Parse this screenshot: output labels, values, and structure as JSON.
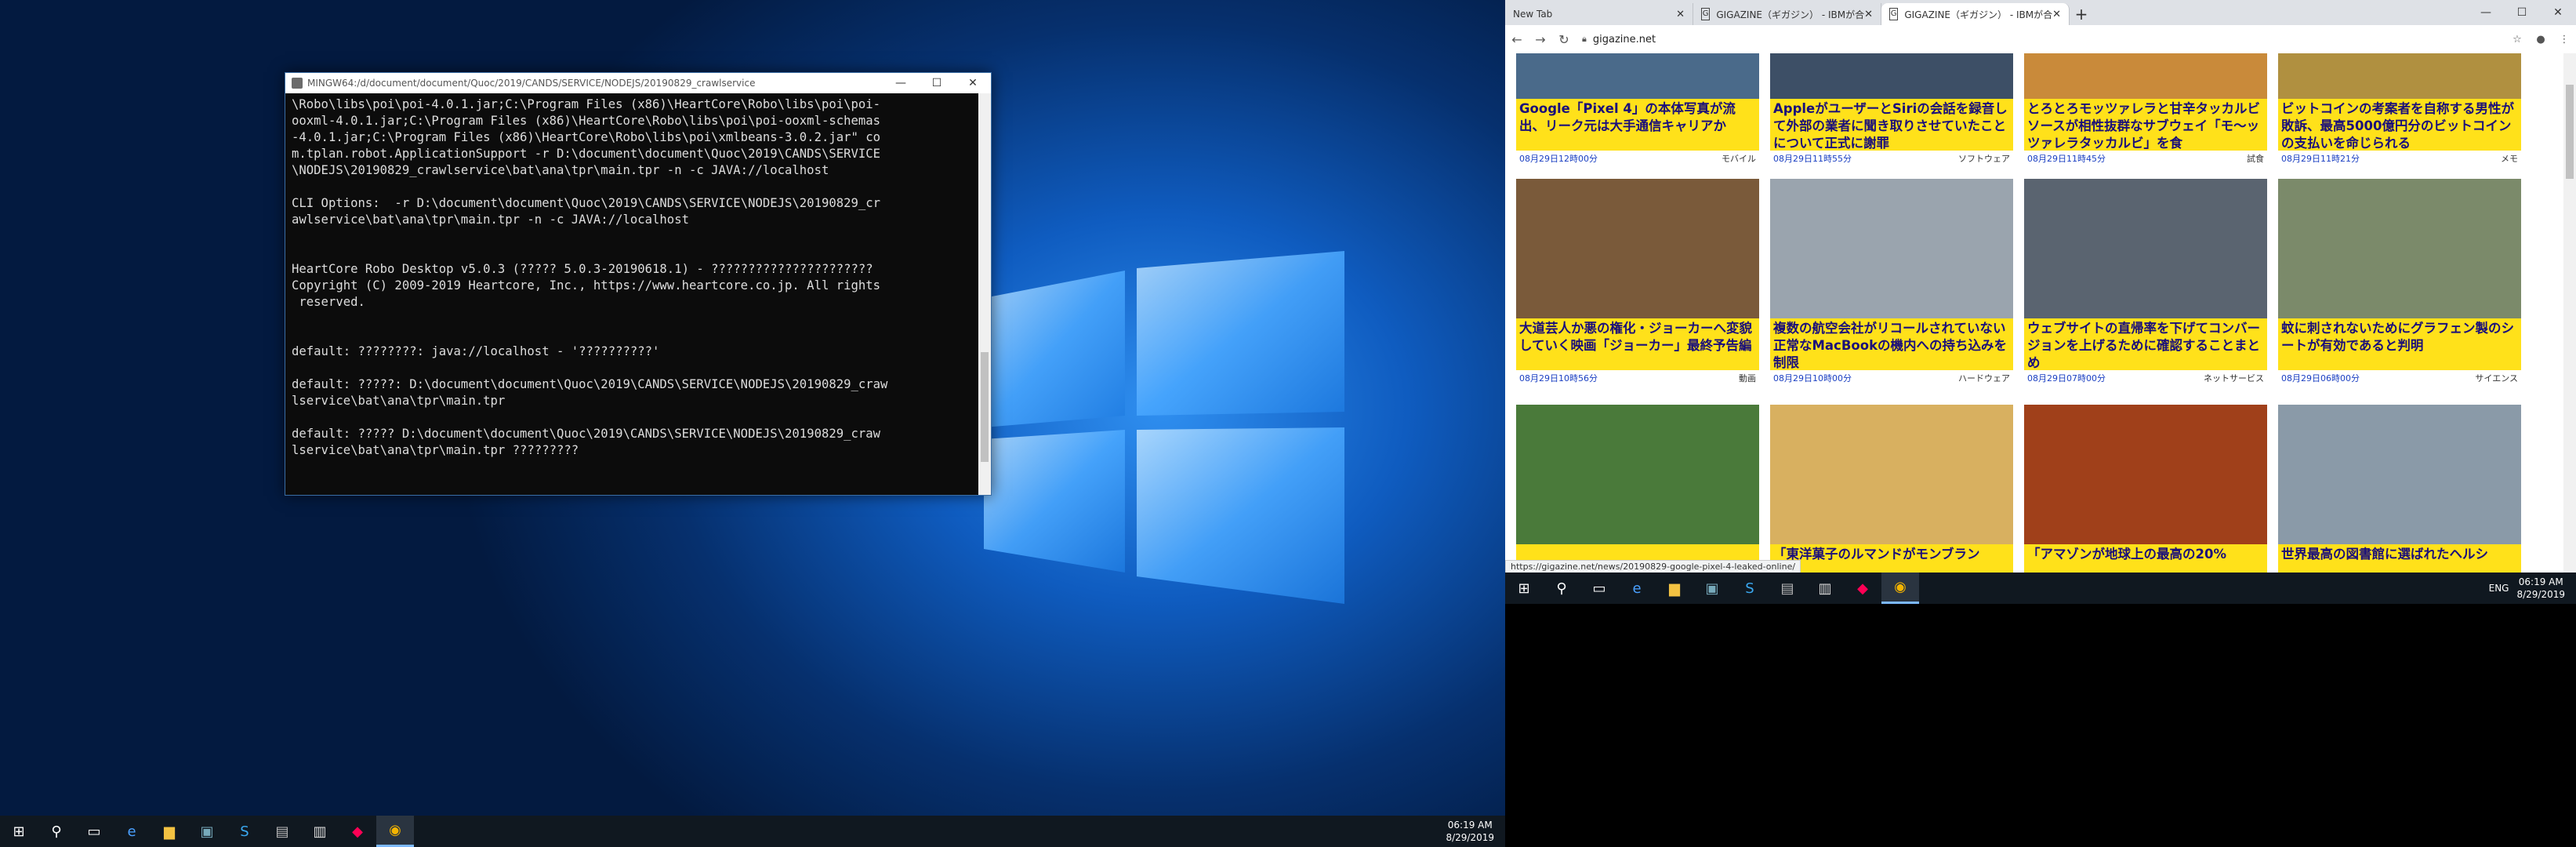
{
  "console": {
    "title": "MINGW64:/d/document/document/Quoc/2019/CANDS/SERVICE/NODEJS/20190829_crawlservice",
    "text": "\\Robo\\libs\\poi\\poi-4.0.1.jar;C:\\Program Files (x86)\\HeartCore\\Robo\\libs\\poi\\poi-\nooxml-4.0.1.jar;C:\\Program Files (x86)\\HeartCore\\Robo\\libs\\poi\\poi-ooxml-schemas\n-4.0.1.jar;C:\\Program Files (x86)\\HeartCore\\Robo\\libs\\poi\\xmlbeans-3.0.2.jar\" co\nm.tplan.robot.ApplicationSupport -r D:\\document\\document\\Quoc\\2019\\CANDS\\SERVICE\n\\NODEJS\\20190829_crawlservice\\bat\\ana\\tpr\\main.tpr -n -c JAVA://localhost\n\nCLI Options:  -r D:\\document\\document\\Quoc\\2019\\CANDS\\SERVICE\\NODEJS\\20190829_cr\nawlservice\\bat\\ana\\tpr\\main.tpr -n -c JAVA://localhost\n\n\nHeartCore Robo Desktop v5.0.3 (????? 5.0.3-20190618.1) - ??????????????????????\nCopyright (C) 2009-2019 Heartcore, Inc., https://www.heartcore.co.jp. All rights\n reserved.\n\n\ndefault: ????????: java://localhost - '??????????'\n\ndefault: ?????: D:\\document\\document\\Quoc\\2019\\CANDS\\SERVICE\\NODEJS\\20190829_craw\nlservice\\bat\\ana\\tpr\\main.tpr\n\ndefault: ????? D:\\document\\document\\Quoc\\2019\\CANDS\\SERVICE\\NODEJS\\20190829_craw\nlservice\\bat\\ana\\tpr\\main.tpr ?????????"
  },
  "taskbar_left": {
    "time": "06:19 AM",
    "date": "8/29/2019"
  },
  "browser": {
    "tabs": [
      {
        "label": "New Tab"
      },
      {
        "label": "GIGAZINE（ギガジン） - IBMが合"
      },
      {
        "label": "GIGAZINE（ギガジン） - IBMが合"
      }
    ],
    "url": "gigazine.net",
    "status_url": "https://gigazine.net/news/20190829-google-pixel-4-leaked-online/",
    "cards": [
      {
        "title": "Google「Pixel 4」の本体写真が流出、リーク元は大手通信キャリアか",
        "date": "08月29日12時00分",
        "cat": "モバイル",
        "thumb": "#4a6a8a"
      },
      {
        "title": "AppleがユーザーとSiriの会話を録音して外部の業者に聞き取りさせていたことについて正式に謝罪",
        "date": "08月29日11時55分",
        "cat": "ソフトウェア",
        "thumb": "#3d4f66"
      },
      {
        "title": "とろとろモッツァレラと甘辛タッカルビソースが相性抜群なサブウェイ「モ～ッツァレラタッカルビ」を食",
        "date": "08月29日11時45分",
        "cat": "試食",
        "thumb": "#c98a3a"
      },
      {
        "title": "ビットコインの考案者を自称する男性が敗訴、最高5000億円分のビットコインの支払いを命じられる",
        "date": "08月29日11時21分",
        "cat": "メモ",
        "thumb": "#b09040"
      },
      {
        "title": "大道芸人か悪の権化・ジョーカーへ変貌していく映画「ジョーカー」最終予告編",
        "date": "08月29日10時56分",
        "cat": "動画",
        "thumb": "#7a5a3a"
      },
      {
        "title": "複数の航空会社がリコールされていない正常なMacBookの機内への持ち込みを制限",
        "date": "08月29日10時00分",
        "cat": "ハードウェア",
        "thumb": "#9aa4ae"
      },
      {
        "title": "ウェブサイトの直帰率を下げてコンバージョンを上げるために確認することまとめ",
        "date": "08月29日07時00分",
        "cat": "ネットサービス",
        "thumb": "#5a6470"
      },
      {
        "title": "蚊に刺されないためにグラフェン製のシートが有効であると判明",
        "date": "08月29日06時00分",
        "cat": "サイエンス",
        "thumb": "#7b8a6a"
      },
      {
        "title": "",
        "date": "",
        "cat": "",
        "thumb": "#4a7a3a"
      },
      {
        "title": "「東洋菓子のルマンドがモンブラン",
        "date": "",
        "cat": "",
        "thumb": "#d8b060"
      },
      {
        "title": "「アマゾンが地球上の最高の20%",
        "date": "",
        "cat": "",
        "thumb": "#a0401a"
      },
      {
        "title": "世界最高の図書館に選ばれたヘルシ",
        "date": "",
        "cat": "",
        "thumb": "#8a9aa8"
      }
    ]
  },
  "taskbar_right": {
    "lang": "ENG",
    "time": "06:19 AM",
    "date": "8/29/2019"
  }
}
